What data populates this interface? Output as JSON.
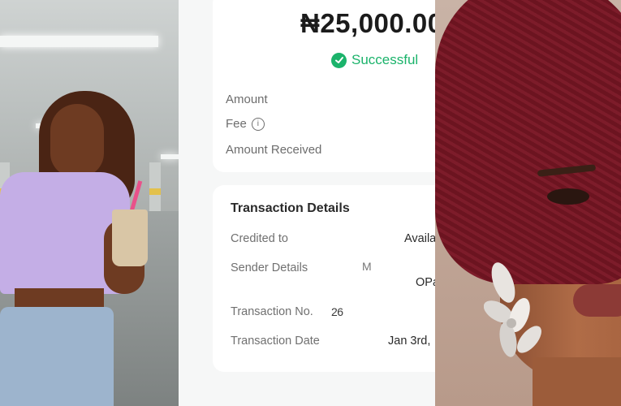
{
  "receipt": {
    "amount": "₦25,000.00",
    "status": "Successful",
    "summary_rows": {
      "amount_label": "Amount",
      "fee_label": "Fee",
      "fee_info_icon": "info-icon",
      "received_label": "Amount Received"
    },
    "details": {
      "title": "Transaction Details",
      "credited_to_label": "Credited to",
      "credited_to_value": "Availa",
      "sender_label": "Sender Details",
      "sender_value_line1": "M",
      "sender_value_line2": "OPa",
      "transaction_no_label": "Transaction No.",
      "transaction_no_value": "26",
      "transaction_date_label": "Transaction Date",
      "transaction_date_value": "Jan 3rd,"
    },
    "colors": {
      "success": "#1bb36b",
      "card_bg": "#ffffff",
      "panel_bg": "#f6f7f7"
    }
  }
}
